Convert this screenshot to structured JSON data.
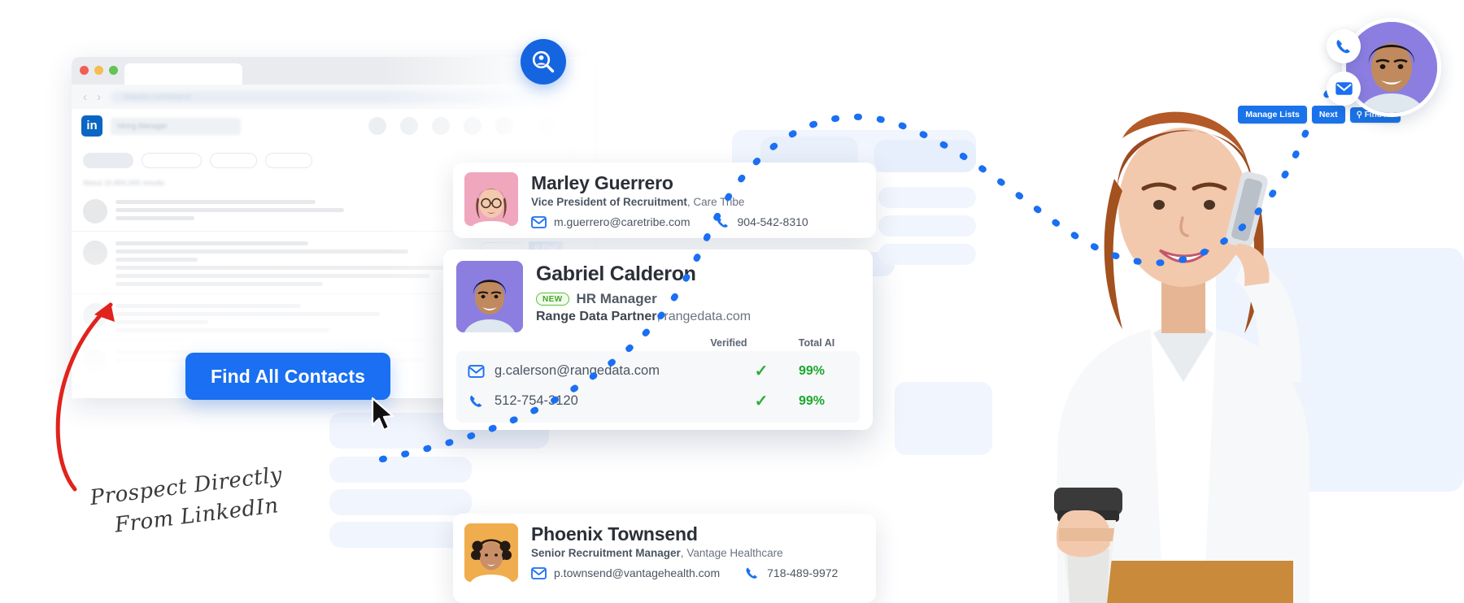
{
  "browser": {
    "url_bar_text": "linkedin.com/search",
    "search_placeholder": "Hiring Manager",
    "logo_label": "in",
    "results_text": "About 10,800,000 results",
    "toolbar": {
      "manage_lists": "Manage Lists",
      "next": "Next",
      "find_all": "Find All",
      "find_all_icon": "search-icon"
    },
    "row_find_label": "Find",
    "row_find_icon": "search-icon",
    "rows": [
      {
        "id": "row-1"
      },
      {
        "id": "row-2"
      },
      {
        "id": "row-3"
      }
    ]
  },
  "cta": {
    "label": "Find All Contacts",
    "color": "#1a6ff2",
    "cursor_icon": "mouse-pointer-icon"
  },
  "annotation": {
    "line1": "Prospect Directly",
    "line2": "From LinkedIn",
    "arrow_icon": "curved-arrow-icon",
    "arrow_color": "#e0231c"
  },
  "badges": {
    "search_badge_icon": "person-search-icon",
    "search_badge_color": "#1565e0",
    "avatar_phone_icon": "phone-icon",
    "avatar_mail_icon": "mail-icon",
    "icon_color": "#1a6ff2"
  },
  "cards": [
    {
      "id": "card-marley",
      "name": "Marley Guerrero",
      "title": "Vice President of Recruitment",
      "company": "Care Tribe",
      "email": "m.guerrero@caretribe.com",
      "phone": "904-542-8310",
      "email_icon": "mail-icon",
      "phone_icon": "phone-icon",
      "photo_bg": "#f0a7bd"
    },
    {
      "id": "card-gabriel",
      "name": "Gabriel Calderon",
      "badge": "NEW",
      "title": "HR Manager",
      "company": "Range Data Partner",
      "website": "rangedata.com",
      "columns": {
        "verified": "Verified",
        "total_ai": "Total AI"
      },
      "rows": [
        {
          "icon": "mail-icon",
          "value": "g.calerson@rangedata.com",
          "verified": "✓",
          "total_ai": "99%"
        },
        {
          "icon": "phone-icon",
          "value": "512-754-3120",
          "verified": "✓",
          "total_ai": "99%"
        }
      ],
      "photo_bg": "#8b7ee0",
      "badge_color": "#44a52a",
      "accent_green": "#1aa72b"
    },
    {
      "id": "card-phoenix",
      "name": "Phoenix Townsend",
      "title": "Senior Recruitment Manager",
      "company": "Vantage Healthcare",
      "email": "p.townsend@vantagehealth.com",
      "phone": "718-489-9972",
      "email_icon": "mail-icon",
      "phone_icon": "phone-icon",
      "photo_bg": "#f0ad4e"
    }
  ],
  "hero_photo": {
    "subject": "woman-on-phone-with-coffee",
    "alt": "Smiling woman holding smartphone and coffee cup"
  }
}
